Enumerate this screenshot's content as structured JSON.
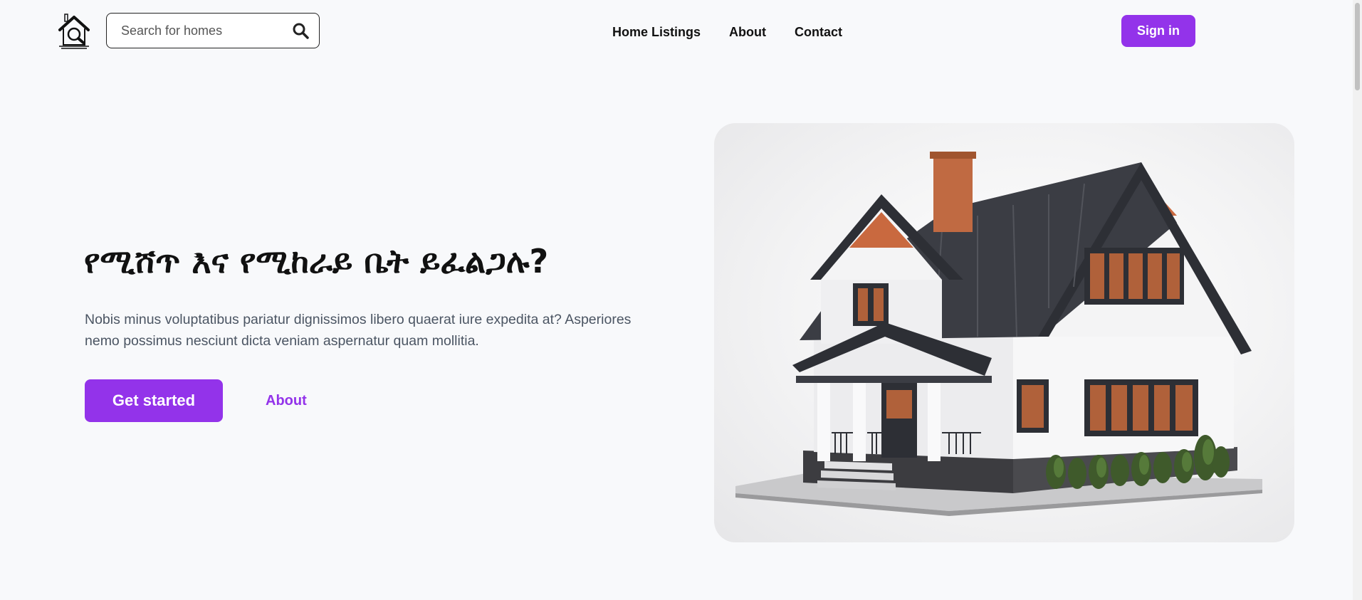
{
  "header": {
    "logo_icon": "house-search-icon",
    "search": {
      "placeholder": "Search for homes",
      "value": "",
      "icon": "search-icon"
    },
    "nav": [
      {
        "label": "Home Listings"
      },
      {
        "label": "About"
      },
      {
        "label": "Contact"
      }
    ],
    "signin_label": "Sign in"
  },
  "hero": {
    "title": "የሚሸጥ እና የሚከራይ ቤት ይፈልጋሉ?",
    "description_line1": "Nobis minus voluptatibus pariatur dignissimos libero quaerat iure expedita at? Asperiores",
    "description_line2": "nemo possimus nesciunt dicta veniam aspernatur quam mollitia.",
    "cta_label": "Get started",
    "secondary_label": "About",
    "image": "house-illustration"
  },
  "colors": {
    "accent": "#9333ea",
    "background": "#f8f9fb",
    "text_muted": "#4b5563"
  }
}
